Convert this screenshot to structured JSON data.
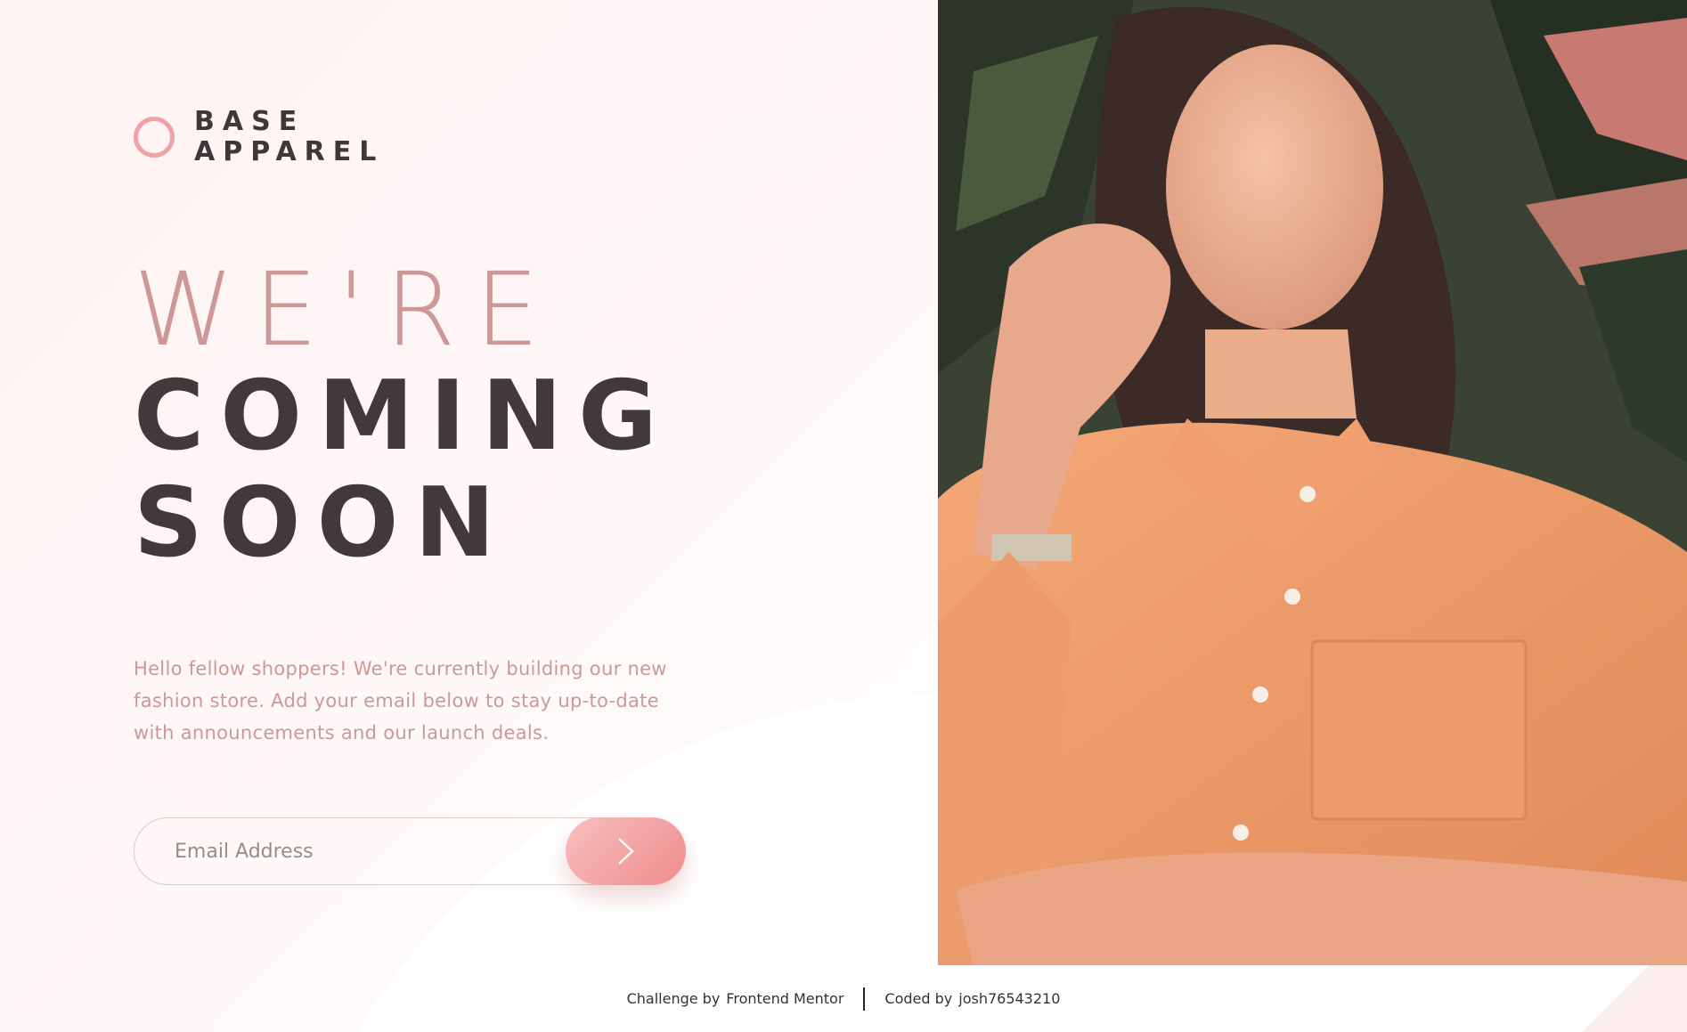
{
  "brand": {
    "line1": "BASE",
    "line2": "APPAREL",
    "accent_color": "#f0a3a6"
  },
  "headline": {
    "line1": "We're",
    "line2": "Coming",
    "line3": "Soon"
  },
  "intro_text": "Hello fellow shoppers! We're currently building our new fashion store. Add your email below to stay up-to-date with announcements and our launch deals.",
  "form": {
    "email_placeholder": "Email Address",
    "email_value": "",
    "submit_icon": "chevron-right-icon"
  },
  "hero_image": {
    "subject": "woman in orange shirt photo"
  },
  "footer": {
    "challenge_label": "Challenge by",
    "challenge_link": "Frontend Mentor",
    "coded_label": "Coded by",
    "coded_link": "josh76543210"
  },
  "colors": {
    "desaturated_red": "#ce9797",
    "dark_grayish_red": "#423a3a",
    "soft_red": "#f96464",
    "button_gradient_start": "#f8bfbf",
    "button_gradient_end": "#ee8c8c"
  }
}
